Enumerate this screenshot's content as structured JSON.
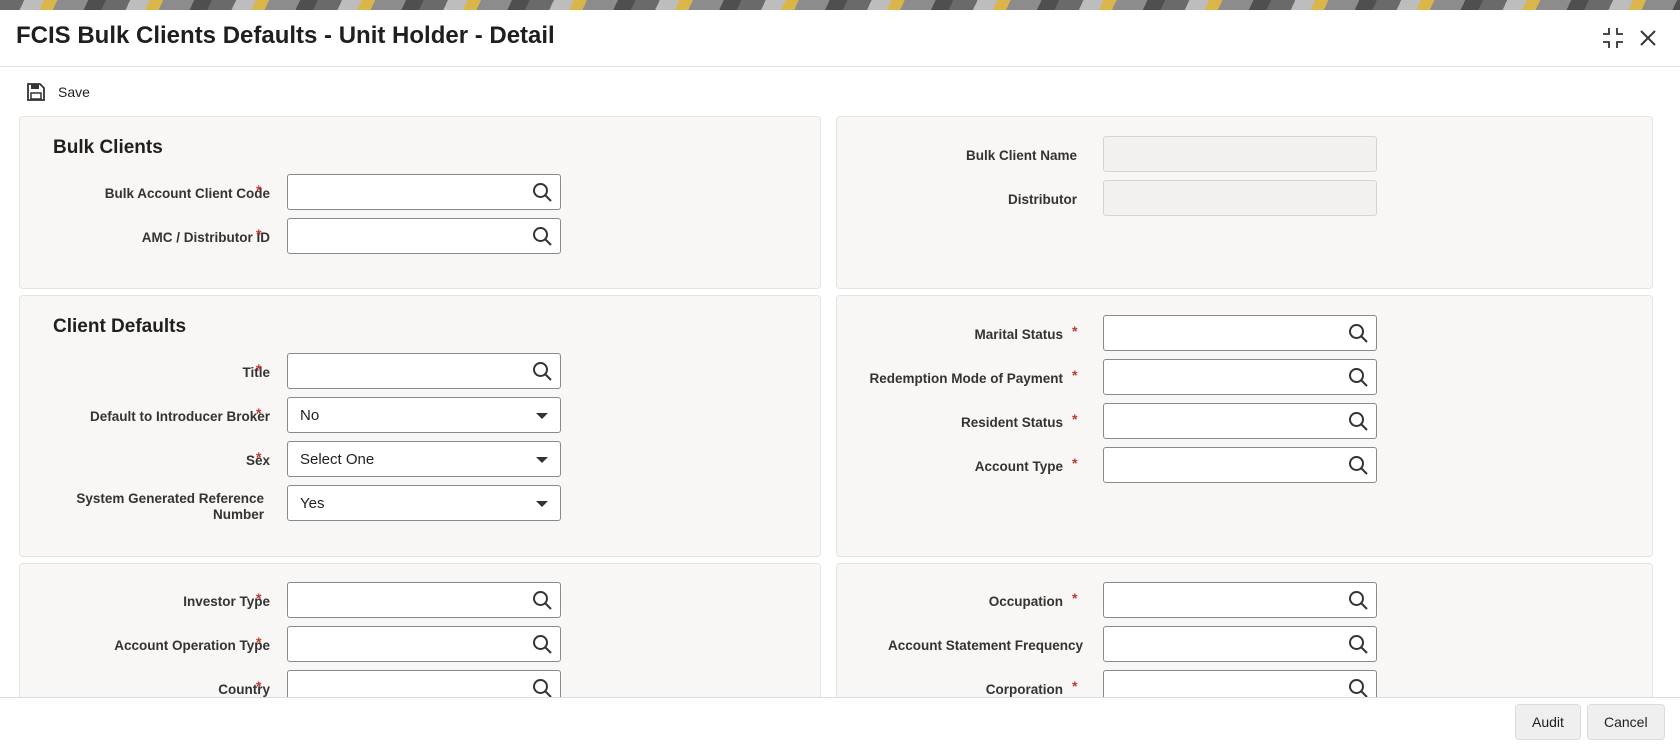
{
  "window": {
    "title": "FCIS Bulk Clients Defaults - Unit Holder - Detail"
  },
  "toolbar": {
    "save_label": "Save"
  },
  "bulk_clients": {
    "section_title": "Bulk Clients",
    "bulk_account_client_code_label": "Bulk Account Client Code",
    "amc_distributor_id_label": "AMC / Distributor ID",
    "bulk_client_name_label": "Bulk Client Name",
    "distributor_label": "Distributor"
  },
  "client_defaults": {
    "section_title": "Client Defaults",
    "title_label": "Title",
    "default_introducer_broker_label": "Default to Introducer Broker",
    "default_introducer_broker_value": "No",
    "sex_label": "Sex",
    "sex_value": "Select One",
    "system_generated_ref_label_line1": "System Generated Reference",
    "system_generated_ref_label_line2": "Number",
    "system_generated_ref_value": "Yes",
    "marital_status_label": "Marital Status",
    "redemption_mode_label": "Redemption Mode of Payment",
    "resident_status_label": "Resident Status",
    "account_type_label": "Account Type"
  },
  "more_defaults": {
    "investor_type_label": "Investor Type",
    "account_operation_type_label": "Account Operation Type",
    "country_label": "Country",
    "occupation_label": "Occupation",
    "account_statement_frequency_label": "Account Statement Frequency",
    "corporation_label": "Corporation"
  },
  "required_marker": "*",
  "footer": {
    "audit_label": "Audit",
    "cancel_label": "Cancel"
  },
  "icons": {
    "lookup": "search-icon",
    "save": "floppy-disk-icon",
    "maximize": "maximize-icon",
    "close": "close-icon",
    "dropdown": "chevron-down-icon"
  }
}
